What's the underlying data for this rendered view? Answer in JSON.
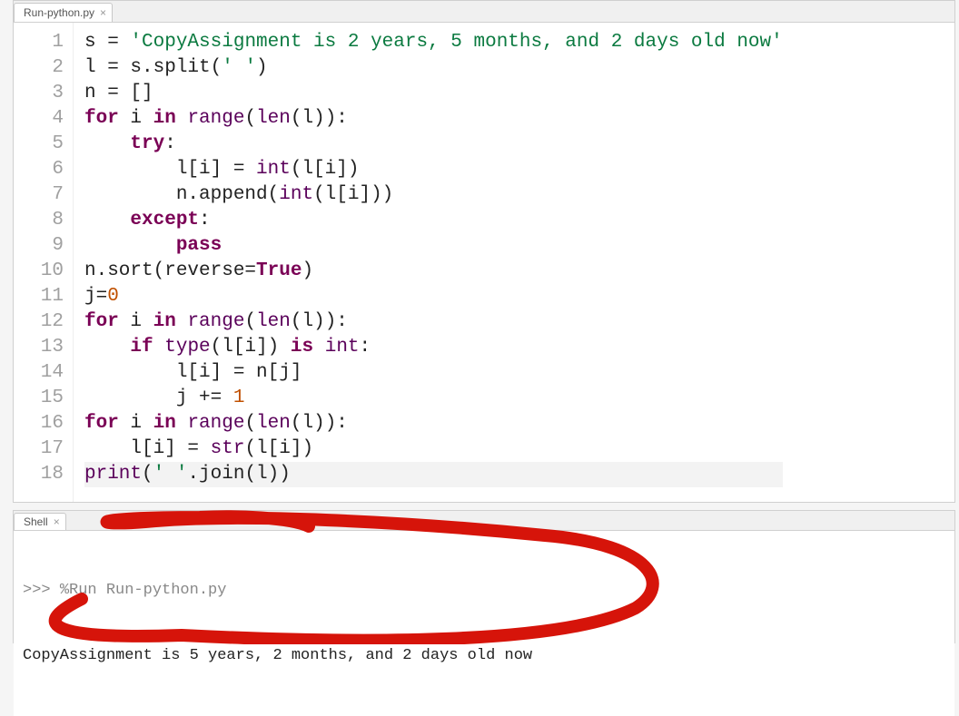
{
  "editor": {
    "tab_label": "Run-python.py",
    "tokens": [
      [
        [
          "",
          "s = "
        ],
        [
          "str",
          "'CopyAssignment is 2 years, 5 months, and 2 days old now'"
        ]
      ],
      [
        [
          "",
          "l = s.split("
        ],
        [
          "str",
          "' '"
        ],
        [
          "",
          ")"
        ]
      ],
      [
        [
          "",
          "n = []"
        ]
      ],
      [
        [
          "kw",
          "for"
        ],
        [
          "",
          " i "
        ],
        [
          "kw",
          "in"
        ],
        [
          "",
          " "
        ],
        [
          "builtin",
          "range"
        ],
        [
          "",
          "("
        ],
        [
          "builtin",
          "len"
        ],
        [
          "",
          "(l)):"
        ]
      ],
      [
        [
          "",
          "    "
        ],
        [
          "kw",
          "try"
        ],
        [
          "",
          ":"
        ]
      ],
      [
        [
          "",
          "        l[i] = "
        ],
        [
          "builtin",
          "int"
        ],
        [
          "",
          "(l[i])"
        ]
      ],
      [
        [
          "",
          "        n.append("
        ],
        [
          "builtin",
          "int"
        ],
        [
          "",
          "(l[i]))"
        ]
      ],
      [
        [
          "",
          "    "
        ],
        [
          "kw",
          "except"
        ],
        [
          "",
          ":"
        ]
      ],
      [
        [
          "",
          "        "
        ],
        [
          "kw",
          "pass"
        ]
      ],
      [
        [
          "",
          "n.sort(reverse="
        ],
        [
          "const",
          "True"
        ],
        [
          "",
          ")"
        ]
      ],
      [
        [
          "",
          "j="
        ],
        [
          "num",
          "0"
        ]
      ],
      [
        [
          "kw",
          "for"
        ],
        [
          "",
          " i "
        ],
        [
          "kw",
          "in"
        ],
        [
          "",
          " "
        ],
        [
          "builtin",
          "range"
        ],
        [
          "",
          "("
        ],
        [
          "builtin",
          "len"
        ],
        [
          "",
          "(l)):"
        ]
      ],
      [
        [
          "",
          "    "
        ],
        [
          "kw",
          "if"
        ],
        [
          "",
          " "
        ],
        [
          "builtin",
          "type"
        ],
        [
          "",
          "(l[i]) "
        ],
        [
          "kw",
          "is"
        ],
        [
          "",
          " "
        ],
        [
          "builtin",
          "int"
        ],
        [
          "",
          ":"
        ]
      ],
      [
        [
          "",
          "        l[i] = n[j]"
        ]
      ],
      [
        [
          "",
          "        j += "
        ],
        [
          "num",
          "1"
        ]
      ],
      [
        [
          "kw",
          "for"
        ],
        [
          "",
          " i "
        ],
        [
          "kw",
          "in"
        ],
        [
          "",
          " "
        ],
        [
          "builtin",
          "range"
        ],
        [
          "",
          "("
        ],
        [
          "builtin",
          "len"
        ],
        [
          "",
          "(l)):"
        ]
      ],
      [
        [
          "",
          "    l[i] = "
        ],
        [
          "builtin",
          "str"
        ],
        [
          "",
          "(l[i])"
        ]
      ],
      [
        [
          "builtin",
          "print"
        ],
        [
          "",
          "("
        ],
        [
          "str",
          "' '"
        ],
        [
          "",
          ".join(l))"
        ]
      ]
    ],
    "highlighted_line_index": 17
  },
  "shell": {
    "tab_label": "Shell",
    "prompt": ">>> ",
    "command": "%Run Run-python.py",
    "output": "CopyAssignment is 5 years, 2 months, and 2 days old now"
  }
}
